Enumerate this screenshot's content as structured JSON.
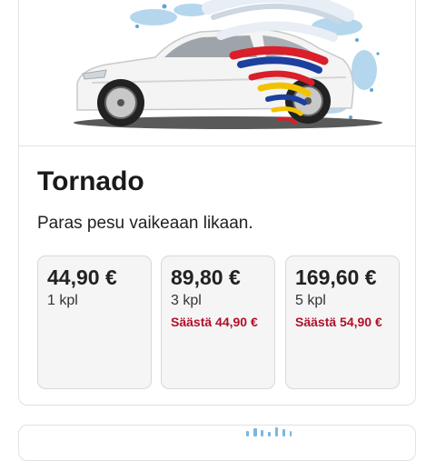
{
  "product": {
    "name": "Tornado",
    "description": "Paras pesu vaikeaan likaan."
  },
  "options": [
    {
      "price": "44,90 €",
      "quantity": "1 kpl",
      "savings": ""
    },
    {
      "price": "89,80 €",
      "quantity": "3 kpl",
      "savings": "Säästä 44,90 €"
    },
    {
      "price": "169,60 €",
      "quantity": "5 kpl",
      "savings": "Säästä 54,90 €"
    }
  ],
  "colors": {
    "savings_text": "#b01028",
    "tile_background": "#f5f5f5",
    "card_border": "#e2e2e2",
    "tornado_red": "#d81f2a",
    "tornado_blue": "#1d3f9e",
    "tornado_yellow": "#f2c200",
    "water_splash": "#7ab8e0"
  },
  "icons": {
    "hero_image": "car-wash-tornado-image",
    "next_card_image": "car-wash-splash-image"
  }
}
